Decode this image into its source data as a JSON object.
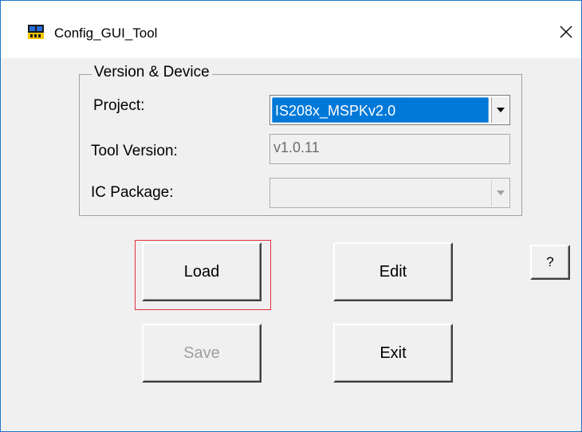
{
  "window": {
    "title": "Config_GUI_Tool",
    "app_icon": "config-tool-icon",
    "close_icon": "close-icon"
  },
  "group": {
    "legend": "Version & Device",
    "project_label": "Project:",
    "project_value": "IS208x_MSPKv2.0",
    "tool_version_label": "Tool Version:",
    "tool_version_value": "v1.0.11",
    "ic_package_label": "IC Package:",
    "ic_package_value": ""
  },
  "buttons": {
    "load": "Load",
    "edit": "Edit",
    "save": "Save",
    "exit": "Exit",
    "help": "?"
  },
  "colors": {
    "selection": "#0078d7",
    "focus_ring": "#e0303a",
    "window_border": "#1e74c8"
  }
}
